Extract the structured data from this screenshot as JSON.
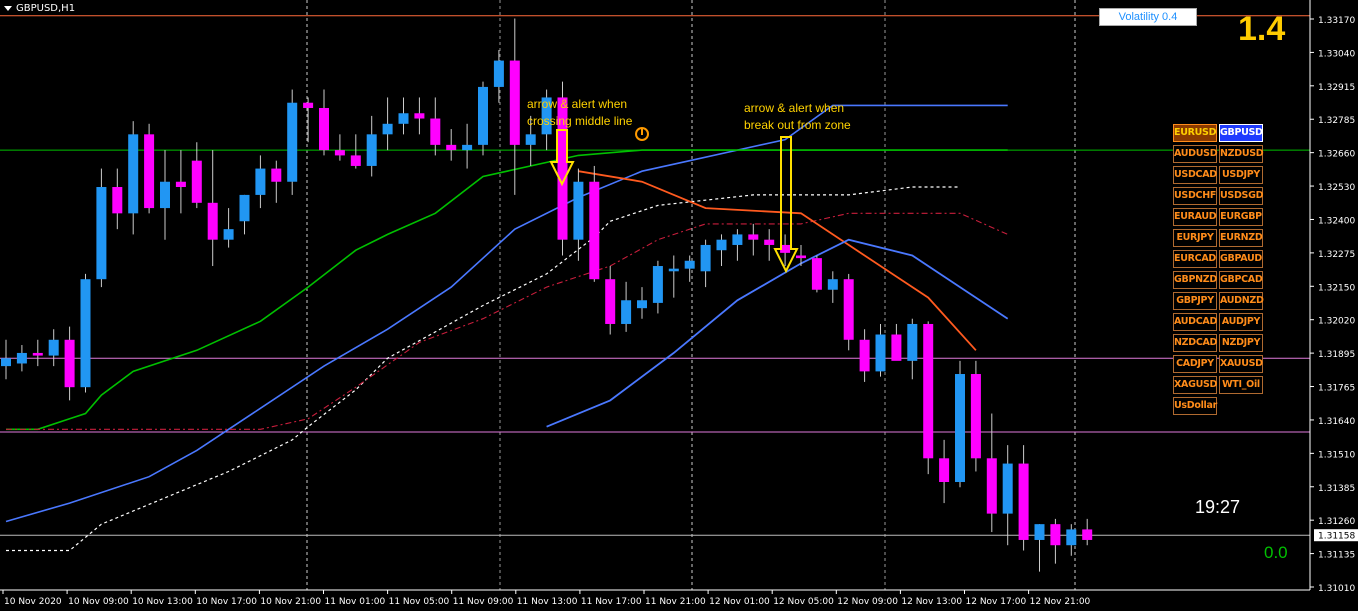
{
  "window": {
    "symbol": "GBPUSD,H1"
  },
  "indicator": {
    "volatility_label": "Volatility 0.4",
    "big_value": "1.4",
    "clock": "19:27",
    "bottom_value": "0.0"
  },
  "annotations": {
    "middle_line_1": "arrow & alert when",
    "middle_line_2": "crossing middle line",
    "zone_line_1": "arrow & alert when",
    "zone_line_2": "break out from zone"
  },
  "pairs": [
    "EURUSD",
    "GBPUSD",
    "AUDUSD",
    "NZDUSD",
    "USDCAD",
    "USDJPY",
    "USDCHF",
    "USDSGD",
    "EURAUD",
    "EURGBP",
    "EURJPY",
    "EURNZD",
    "EURCAD",
    "GBPAUD",
    "GBPNZD",
    "GBPCAD",
    "GBPJPY",
    "AUDNZD",
    "AUDCAD",
    "AUDJPY",
    "NZDCAD",
    "NZDJPY",
    "CADJPY",
    "XAUUSD",
    "XAGUSD",
    "WTI_Oil",
    "UsDollar"
  ],
  "colors": {
    "bull": "#2196f3",
    "bear": "#ff00ff",
    "upper_band": "#ff5a1f",
    "lower_band": "#4a78ff",
    "green_band": "#00c000",
    "middle_line": "#ffffff",
    "dashdot": "#c81e3c"
  },
  "chart_data": {
    "type": "candlestick",
    "symbol": "GBPUSD",
    "timeframe": "H1",
    "ylim": [
      1.3095,
      1.3319
    ],
    "y_ticks": [
      "1.33170",
      "1.33040",
      "1.32915",
      "1.32785",
      "1.32660",
      "1.32530",
      "1.32400",
      "1.32275",
      "1.32150",
      "1.32020",
      "1.31895",
      "1.31765",
      "1.31640",
      "1.31510",
      "1.31385",
      "1.31260",
      "1.31135",
      "1.31010"
    ],
    "x_tick_labels": [
      "10 Nov 2020",
      "10 Nov 09:00",
      "10 Nov 13:00",
      "10 Nov 17:00",
      "10 Nov 21:00",
      "11 Nov 01:00",
      "11 Nov 05:00",
      "11 Nov 09:00",
      "11 Nov 13:00",
      "11 Nov 17:00",
      "11 Nov 21:00",
      "12 Nov 01:00",
      "12 Nov 05:00",
      "12 Nov 09:00",
      "12 Nov 13:00",
      "12 Nov 17:00",
      "12 Nov 21:00"
    ],
    "current_price": "1.31158",
    "horizontal_levels": [
      {
        "price": 1.3313,
        "color": "#ff6a3a"
      },
      {
        "price": 1.3262,
        "color": "#00c000"
      },
      {
        "price": 1.3183,
        "color": "#e07adb"
      },
      {
        "price": 1.3155,
        "color": "#e07adb"
      }
    ],
    "candles": [
      [
        1.318,
        1.319,
        1.3175,
        1.3183
      ],
      [
        1.3181,
        1.3188,
        1.3178,
        1.3185
      ],
      [
        1.3185,
        1.319,
        1.318,
        1.3184
      ],
      [
        1.3184,
        1.3194,
        1.318,
        1.319
      ],
      [
        1.319,
        1.3195,
        1.3167,
        1.3172
      ],
      [
        1.3172,
        1.3215,
        1.317,
        1.3213
      ],
      [
        1.3213,
        1.3255,
        1.321,
        1.3248
      ],
      [
        1.3248,
        1.3255,
        1.3232,
        1.3238
      ],
      [
        1.3238,
        1.3273,
        1.323,
        1.3268
      ],
      [
        1.3268,
        1.3272,
        1.3238,
        1.324
      ],
      [
        1.324,
        1.3262,
        1.3228,
        1.325
      ],
      [
        1.325,
        1.3262,
        1.3238,
        1.3248
      ],
      [
        1.3258,
        1.3265,
        1.324,
        1.3242
      ],
      [
        1.3242,
        1.3262,
        1.3218,
        1.3228
      ],
      [
        1.3228,
        1.324,
        1.3225,
        1.3232
      ],
      [
        1.3235,
        1.3245,
        1.323,
        1.3245
      ],
      [
        1.3245,
        1.326,
        1.324,
        1.3255
      ],
      [
        1.3255,
        1.3258,
        1.3242,
        1.325
      ],
      [
        1.325,
        1.3285,
        1.3245,
        1.328
      ],
      [
        1.328,
        1.3282,
        1.3265,
        1.3278
      ],
      [
        1.3278,
        1.3285,
        1.326,
        1.3262
      ],
      [
        1.3262,
        1.3268,
        1.3258,
        1.326
      ],
      [
        1.326,
        1.3268,
        1.3255,
        1.3256
      ],
      [
        1.3256,
        1.3275,
        1.3252,
        1.3268
      ],
      [
        1.3268,
        1.3282,
        1.3262,
        1.3272
      ],
      [
        1.3272,
        1.3282,
        1.3268,
        1.3276
      ],
      [
        1.3276,
        1.3282,
        1.3268,
        1.3274
      ],
      [
        1.3274,
        1.3282,
        1.326,
        1.3264
      ],
      [
        1.3264,
        1.327,
        1.3258,
        1.3262
      ],
      [
        1.3262,
        1.3272,
        1.3255,
        1.3264
      ],
      [
        1.3264,
        1.3288,
        1.326,
        1.3286
      ],
      [
        1.3286,
        1.33,
        1.328,
        1.3296
      ],
      [
        1.3296,
        1.3312,
        1.3245,
        1.3264
      ],
      [
        1.3264,
        1.3275,
        1.3256,
        1.3268
      ],
      [
        1.3268,
        1.3285,
        1.3262,
        1.3282
      ],
      [
        1.3282,
        1.3288,
        1.3222,
        1.3228
      ],
      [
        1.3228,
        1.3255,
        1.322,
        1.325
      ],
      [
        1.325,
        1.3256,
        1.3212,
        1.3213
      ],
      [
        1.3213,
        1.3218,
        1.3192,
        1.3196
      ],
      [
        1.3196,
        1.3212,
        1.3193,
        1.3205
      ],
      [
        1.3202,
        1.321,
        1.3198,
        1.3205
      ],
      [
        1.3204,
        1.322,
        1.32,
        1.3218
      ],
      [
        1.3216,
        1.3222,
        1.3206,
        1.3217
      ],
      [
        1.3217,
        1.3222,
        1.3212,
        1.322
      ],
      [
        1.3216,
        1.3228,
        1.321,
        1.3226
      ],
      [
        1.3224,
        1.323,
        1.3218,
        1.3228
      ],
      [
        1.3226,
        1.3232,
        1.322,
        1.323
      ],
      [
        1.323,
        1.3234,
        1.3222,
        1.3228
      ],
      [
        1.3228,
        1.3232,
        1.322,
        1.3226
      ],
      [
        1.3226,
        1.323,
        1.3218,
        1.3223
      ],
      [
        1.3222,
        1.3226,
        1.3218,
        1.3221
      ],
      [
        1.3221,
        1.3222,
        1.3208,
        1.3209
      ],
      [
        1.3209,
        1.3216,
        1.3204,
        1.3213
      ],
      [
        1.3213,
        1.3215,
        1.3186,
        1.319
      ],
      [
        1.319,
        1.3194,
        1.3174,
        1.3178
      ],
      [
        1.3178,
        1.3196,
        1.3176,
        1.3192
      ],
      [
        1.3192,
        1.3196,
        1.3183,
        1.3182
      ],
      [
        1.3182,
        1.3198,
        1.3175,
        1.3196
      ],
      [
        1.3196,
        1.3197,
        1.3139,
        1.3145
      ],
      [
        1.3145,
        1.3152,
        1.3128,
        1.3136
      ],
      [
        1.3136,
        1.3182,
        1.3134,
        1.3177
      ],
      [
        1.3177,
        1.3182,
        1.314,
        1.3145
      ],
      [
        1.3145,
        1.3162,
        1.3117,
        1.3124
      ],
      [
        1.3124,
        1.315,
        1.3112,
        1.3143
      ],
      [
        1.3143,
        1.315,
        1.311,
        1.3114
      ],
      [
        1.3114,
        1.312,
        1.3102,
        1.312
      ],
      [
        1.312,
        1.3122,
        1.3105,
        1.3112
      ],
      [
        1.3112,
        1.312,
        1.3108,
        1.3118
      ],
      [
        1.3118,
        1.3122,
        1.3112,
        1.3114
      ]
    ]
  }
}
